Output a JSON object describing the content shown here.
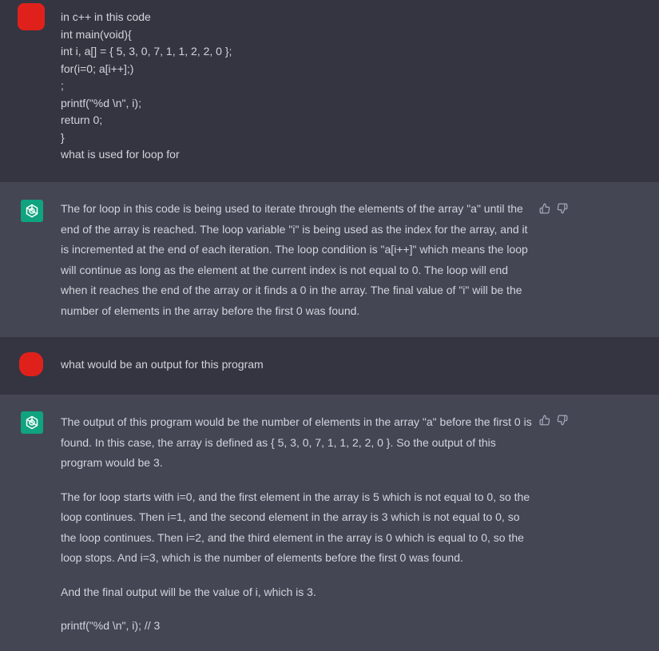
{
  "conversation": [
    {
      "role": "user",
      "lines": [
        "in c++ in this code",
        "int main(void){",
        "int i, a[] = { 5, 3, 0, 7, 1, 1, 2, 2, 0 };",
        "for(i=0; a[i++];)",
        ";",
        "printf(\"%d \\n\", i);",
        "return 0;",
        "}",
        "what is used for loop for"
      ]
    },
    {
      "role": "assistant",
      "paragraphs": [
        "The for loop in this code is being used to iterate through the elements of the array \"a\" until the end of the array is reached. The loop variable \"i\" is being used as the index for the array, and it is incremented at the end of each iteration. The loop condition is \"a[i++]\" which means the loop will continue as long as the element at the current index is not equal to 0. The loop will end when it reaches the end of the array or it finds a 0 in the array. The final value of \"i\" will be the number of elements in the array before the first 0 was found."
      ]
    },
    {
      "role": "user",
      "lines": [
        "what would be an output for this program"
      ]
    },
    {
      "role": "assistant",
      "paragraphs": [
        "The output of this program would be the number of elements in the array \"a\" before the first 0 is found. In this case, the array is defined as { 5, 3, 0, 7, 1, 1, 2, 2, 0 }. So the output of this program would be 3.",
        "The for loop starts with i=0, and the first element in the array is 5 which is not equal to 0, so the loop continues. Then i=1, and the second element in the array is 3 which is not equal to 0, so the loop continues. Then i=2, and the third element in the array is 0 which is equal to 0, so the loop stops. And i=3, which is the number of elements before the first 0 was found.",
        "And the final output will be the value of i, which is 3.",
        "printf(\"%d \\n\", i); // 3"
      ]
    }
  ],
  "icons": {
    "assistant_avatar": "openai-logo-icon",
    "like": "thumbs-up-icon",
    "dislike": "thumbs-down-icon"
  },
  "colors": {
    "user_bg": "#343541",
    "assistant_bg": "#444654",
    "assistant_avatar": "#10a37f",
    "user_avatar": "#e0211b",
    "text": "#d1d5db"
  }
}
